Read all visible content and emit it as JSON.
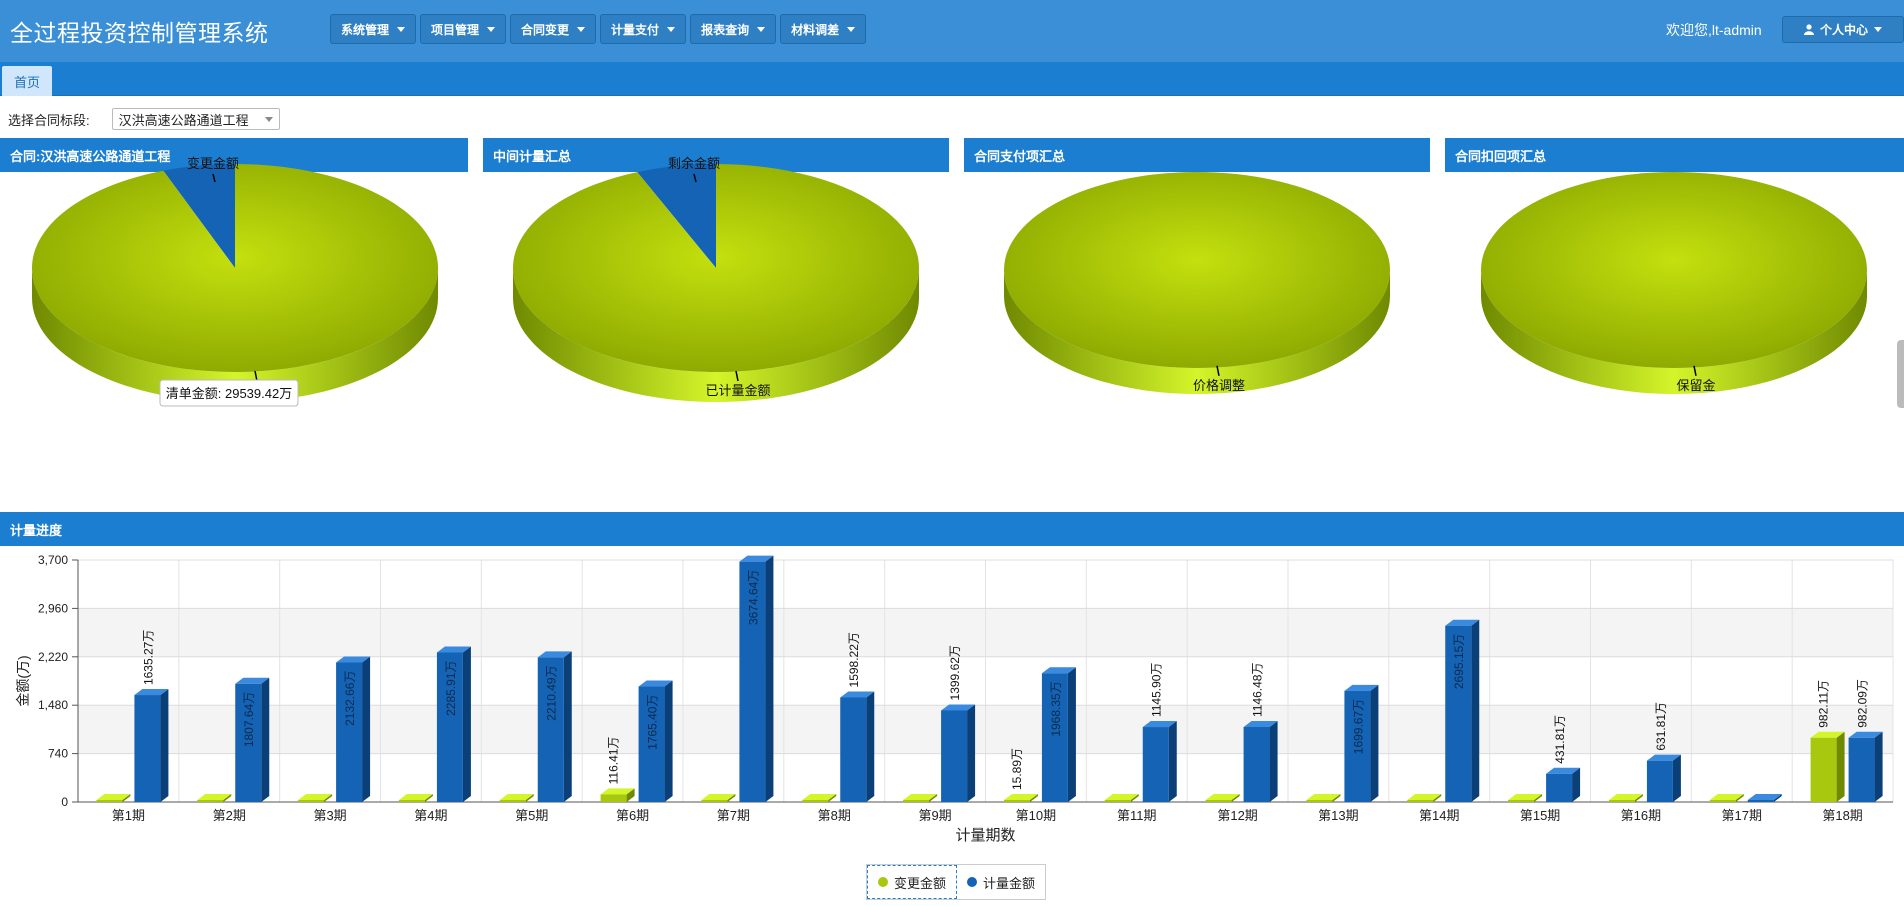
{
  "app": {
    "title": "全过程投资控制管理系统"
  },
  "menu": [
    {
      "label": "系统管理"
    },
    {
      "label": "项目管理"
    },
    {
      "label": "合同变更"
    },
    {
      "label": "计量支付"
    },
    {
      "label": "报表查询"
    },
    {
      "label": "材料调差"
    }
  ],
  "header": {
    "welcome": "欢迎您,lt-admin",
    "user_center": "个人中心"
  },
  "tabs": [
    {
      "label": "首页"
    }
  ],
  "selector": {
    "label": "选择合同标段:",
    "value": "汉洪高速公路通道工程"
  },
  "panels": [
    {
      "title": "合同:汉洪高速公路通道工程"
    },
    {
      "title": "中间计量汇总"
    },
    {
      "title": "合同支付项汇总"
    },
    {
      "title": "合同扣回项汇总"
    }
  ],
  "tooltip": {
    "text": "清单金额: 29539.42万"
  },
  "section": {
    "title": "计量进度"
  },
  "colors": {
    "green": "#a7c80f",
    "blue": "#1463b4",
    "header": "#1b7ed0",
    "topbar": "#3b8fd6"
  },
  "chart_data": [
    {
      "type": "pie",
      "slices": [
        {
          "name": "清单金额",
          "value": 29539.42
        },
        {
          "name": "变更金额",
          "value": 1800
        }
      ],
      "callouts": {
        "top": "变更金额",
        "bottom": "清单金额"
      }
    },
    {
      "type": "pie",
      "slices": [
        {
          "name": "已计量金额",
          "value": 29539.42
        },
        {
          "name": "剩余金额",
          "value": 2000
        }
      ],
      "callouts": {
        "top": "剩余金额",
        "bottom": "已计量金额"
      }
    },
    {
      "type": "pie",
      "slices": [
        {
          "name": "价格调整",
          "value": 100
        }
      ],
      "callouts": {
        "top": "",
        "bottom": "价格调整"
      }
    },
    {
      "type": "pie",
      "slices": [
        {
          "name": "保留金",
          "value": 100
        }
      ],
      "callouts": {
        "top": "",
        "bottom": "保留金"
      }
    },
    {
      "type": "bar",
      "categories": [
        "第1期",
        "第2期",
        "第3期",
        "第4期",
        "第5期",
        "第6期",
        "第7期",
        "第8期",
        "第9期",
        "第10期",
        "第11期",
        "第12期",
        "第13期",
        "第14期",
        "第15期",
        "第16期",
        "第17期",
        "第18期"
      ],
      "series": [
        {
          "name": "变更金额",
          "values": [
            0,
            0,
            0,
            0,
            0,
            116.41,
            0,
            0,
            0,
            15.89,
            0,
            0,
            0,
            0,
            0,
            0,
            0,
            982.11
          ],
          "labels": [
            "",
            "",
            "",
            "",
            "",
            "116.41万",
            "",
            "",
            "",
            "15.89万",
            "",
            "",
            "",
            "",
            "",
            "",
            "",
            "982.11万"
          ]
        },
        {
          "name": "计量金额",
          "values": [
            1635.27,
            1807.64,
            2132.66,
            2285.91,
            2210.49,
            1765.4,
            3674.64,
            1598.22,
            1399.62,
            1968.35,
            1145.9,
            1146.48,
            1699.67,
            2695.15,
            431.81,
            631.81,
            0,
            982.09
          ],
          "labels": [
            "1635.27万",
            "1807.64万",
            "2132.66万",
            "2285.91万",
            "2210.49万",
            "1765.40万",
            "3674.64万",
            "1598.22万",
            "1399.62万",
            "1968.35万",
            "1145.90万",
            "1146.48万",
            "1699.67万",
            "2695.15万",
            "431.81万",
            "631.81万",
            "",
            "982.09万"
          ]
        }
      ],
      "xlabel": "计量期数",
      "ylabel": "金额(万)",
      "yticks": [
        "0",
        "740",
        "1,480",
        "2,220",
        "2,960",
        "3,700"
      ],
      "ylim": [
        0,
        3700
      ],
      "legend": "bottom-center"
    }
  ]
}
